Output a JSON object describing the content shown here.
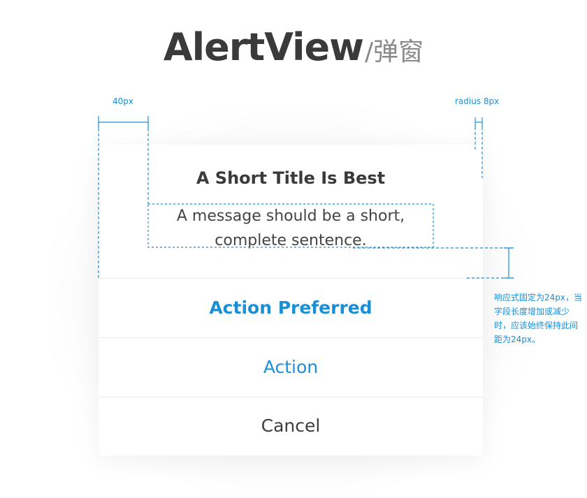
{
  "heading": {
    "main": "AlertView",
    "sub": "/弹窗"
  },
  "alert": {
    "title": "A Short Title Is Best",
    "message_line1": "A message should be a short,",
    "message_line2": "complete sentence.",
    "actions": [
      {
        "label": "Action Preferred",
        "style": "preferred"
      },
      {
        "label": "Action",
        "style": "default"
      },
      {
        "label": "Cancel",
        "style": "cancel"
      }
    ]
  },
  "annotations": {
    "padding_label": "40px",
    "radius_label": "radius 8px",
    "spacing_note": "响应式固定为24px，当字段长度增加或减少时，应该始终保持此间距为24px。"
  },
  "colors": {
    "accent": "#1b8fd6",
    "title_text": "#3a3a3a",
    "cancel_text": "#3d3d3d",
    "divider": "#ebebeb"
  }
}
